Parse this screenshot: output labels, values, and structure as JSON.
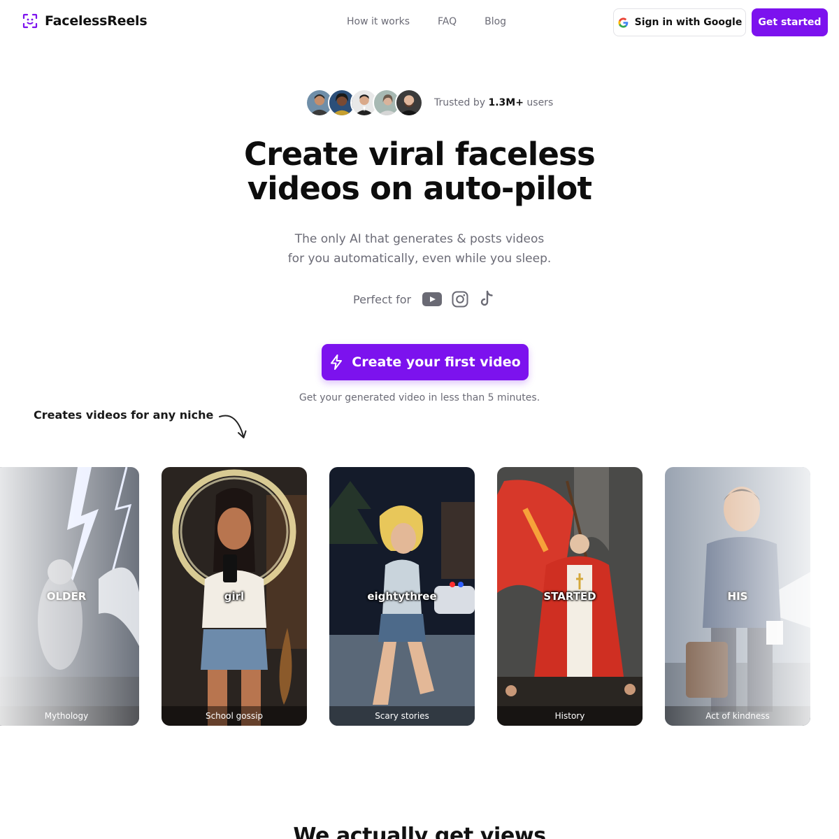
{
  "header": {
    "brand": "FacelessReels",
    "nav": [
      "How it works",
      "FAQ",
      "Blog"
    ],
    "google_button": "Sign in with Google",
    "get_started": "Get started"
  },
  "trusted": {
    "prefix": "Trusted by",
    "count": "1.3M+",
    "suffix": "users",
    "avatar_count": 5
  },
  "hero": {
    "title_line1": "Create viral faceless",
    "title_line2": "videos on auto-pilot",
    "subtitle_line1": "The only AI that generates & posts videos",
    "subtitle_line2": "for you automatically, even while you sleep.",
    "perfect_for": "Perfect for",
    "platforms": [
      "youtube-icon",
      "instagram-icon",
      "tiktok-icon"
    ],
    "cta": "Create your first video",
    "cta_note": "Get your generated video in less than 5 minutes."
  },
  "niches": {
    "label": "Creates videos for any niche",
    "cards": [
      {
        "caption": "OLDER",
        "label": "Mythology"
      },
      {
        "caption": "girl",
        "label": "School gossip"
      },
      {
        "caption": "eightythree",
        "label": "Scary stories"
      },
      {
        "caption": "STARTED",
        "label": "History"
      },
      {
        "caption": "HIS",
        "label": "Act of kindness"
      }
    ]
  },
  "next_section": {
    "title": "We actually get views"
  },
  "colors": {
    "accent": "#7c12ee",
    "muted_text": "#6b6b76"
  }
}
